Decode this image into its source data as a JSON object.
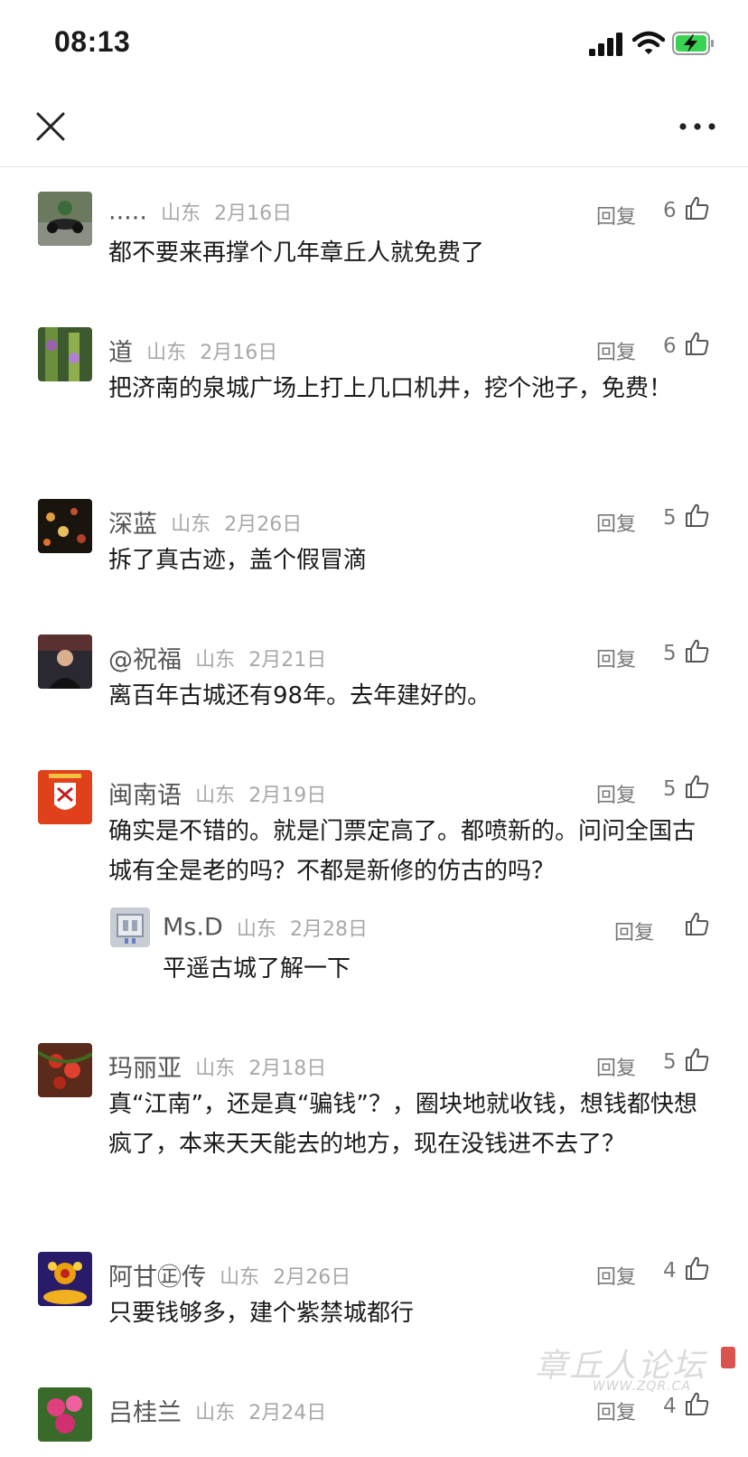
{
  "status_bar": {
    "time": "08:13"
  },
  "nav": {
    "close_icon": "close-icon",
    "more_icon": "more-horizontal-icon"
  },
  "labels": {
    "reply": "回复"
  },
  "comments": [
    {
      "user": ".....",
      "region": "山东",
      "date": "2月16日",
      "likes": "6",
      "text": "都不要来再撑个几年章丘人就免费了"
    },
    {
      "user": "道",
      "region": "山东",
      "date": "2月16日",
      "likes": "6",
      "text": "把济南的泉城广场上打上几口机井，挖个池子，免费！"
    },
    {
      "user": "深蓝",
      "region": "山东",
      "date": "2月26日",
      "likes": "5",
      "text": "拆了真古迹，盖个假冒滴"
    },
    {
      "user": "@祝福",
      "region": "山东",
      "date": "2月21日",
      "likes": "5",
      "text": "离百年古城还有98年。去年建好的。"
    },
    {
      "user": "闽南语",
      "region": "山东",
      "date": "2月19日",
      "likes": "5",
      "text": "确实是不错的。就是门票定高了。都喷新的。问问全国古城有全是老的吗？不都是新修的仿古的吗？"
    },
    {
      "user": "Ms.D",
      "region": "山东",
      "date": "2月28日",
      "likes": "",
      "text": "平遥古城了解一下"
    },
    {
      "user": "玛丽亚",
      "region": "山东",
      "date": "2月18日",
      "likes": "5",
      "text": "真“江南”，还是真“骗钱”？，圈块地就收钱，想钱都快想疯了，本来天天能去的地方，现在没钱进不去了？"
    },
    {
      "user": "阿甘㊣传",
      "region": "山东",
      "date": "2月26日",
      "likes": "4",
      "text": "只要钱够多，建个紫禁城都行"
    },
    {
      "user": "吕桂兰",
      "region": "山东",
      "date": "2月24日",
      "likes": "4",
      "text": ""
    }
  ],
  "watermark": {
    "text": "章丘人论坛",
    "url": "WWW.ZQR.CA"
  },
  "colors": {
    "name": "#555555",
    "meta": "#a8a8a8",
    "text": "#1a1a1a",
    "divider": "#e6e6e6"
  }
}
